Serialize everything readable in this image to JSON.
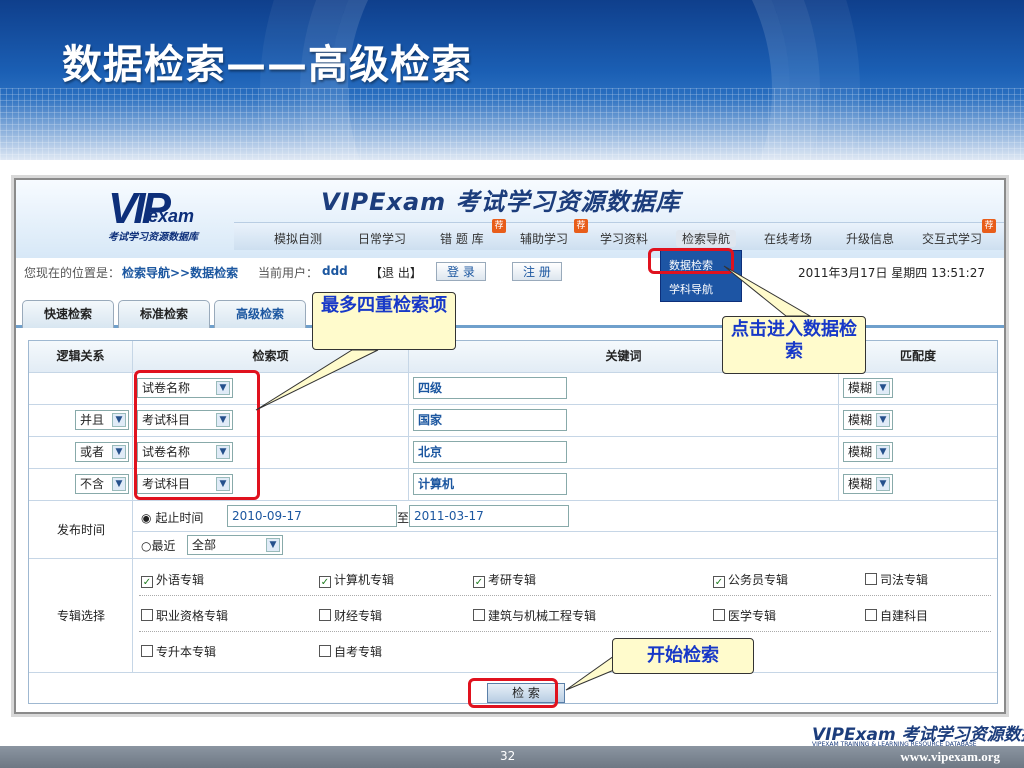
{
  "slide": {
    "title": "数据检索——高级检索",
    "page_number": "32",
    "footer_url": "www.vipexam.org",
    "footer_logo": "VIPExam 考试学习资源数据库",
    "footer_sub": "VIPEXAM TRAINING & LEARNING RESOURCE DATABASE"
  },
  "site": {
    "logo_mark": "VIP",
    "logo_sub": "exam",
    "logo_cn": "考试学习资源数据库",
    "brand": "VIPExam 考试学习资源数据库",
    "nav": [
      "模拟自测",
      "日常学习",
      "错 题 库",
      "辅助学习",
      "学习资料",
      "检索导航",
      "在线考场",
      "升级信息",
      "交互式学习"
    ],
    "nav_tag": "荐",
    "dropdown": [
      "数据检索",
      "学科导航"
    ]
  },
  "locbar": {
    "prefix": "您现在的位置是：",
    "path": "检索导航>>数据检索",
    "user_label": "当前用户：",
    "user": "ddd",
    "logout": "【退 出】",
    "login_btn": "登 录",
    "register_btn": "注 册",
    "datetime": "2011年3月17日 星期四 13:51:27"
  },
  "tabs": [
    "快速检索",
    "标准检索",
    "高级检索"
  ],
  "form": {
    "headers": {
      "logic": "逻辑关系",
      "field": "检索项",
      "keyword": "关键词",
      "match": "匹配度"
    },
    "rows": [
      {
        "logic": "",
        "field": "试卷名称",
        "keyword": "四级",
        "match": "模糊"
      },
      {
        "logic": "并且",
        "field": "考试科目",
        "keyword": "国家",
        "match": "模糊"
      },
      {
        "logic": "或者",
        "field": "试卷名称",
        "keyword": "北京",
        "match": "模糊"
      },
      {
        "logic": "不含",
        "field": "考试科目",
        "keyword": "计算机",
        "match": "模糊"
      }
    ],
    "date": {
      "label": "发布时间",
      "deadline_label": "起止时间",
      "from": "2010-09-17",
      "to_label": "至",
      "to": "2011-03-17",
      "recent_label": "最近",
      "recent_value": "全部"
    },
    "topics": {
      "label": "专辑选择",
      "items": [
        {
          "name": "外语专辑",
          "checked": true
        },
        {
          "name": "计算机专辑",
          "checked": true
        },
        {
          "name": "考研专辑",
          "checked": true
        },
        {
          "name": "公务员专辑",
          "checked": true
        },
        {
          "name": "司法专辑",
          "checked": false
        },
        {
          "name": "职业资格专辑",
          "checked": false
        },
        {
          "name": "财经专辑",
          "checked": false
        },
        {
          "name": "建筑与机械工程专辑",
          "checked": false
        },
        {
          "name": "医学专辑",
          "checked": false
        },
        {
          "name": "自建科目",
          "checked": false
        },
        {
          "name": "专升本专辑",
          "checked": false
        },
        {
          "name": "自考专辑",
          "checked": false
        }
      ]
    },
    "search_btn": "检 索"
  },
  "callouts": {
    "four_items": "最多四重检索项",
    "enter_search": "点击进入数据检索",
    "start_search": "开始检索"
  },
  "check_mark": "✓",
  "arrow_glyph": "▼"
}
